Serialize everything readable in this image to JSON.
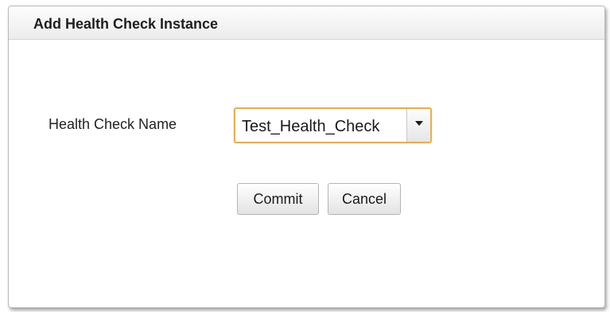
{
  "dialog": {
    "title": "Add Health Check Instance",
    "field_label": "Health Check Name",
    "select_value": "Test_Health_Check",
    "commit_label": "Commit",
    "cancel_label": "Cancel",
    "icons": {
      "dropdown": "chevron-down-icon"
    },
    "colors": {
      "focus_border": "#e3b05a",
      "header_bg": "#ececec"
    }
  }
}
